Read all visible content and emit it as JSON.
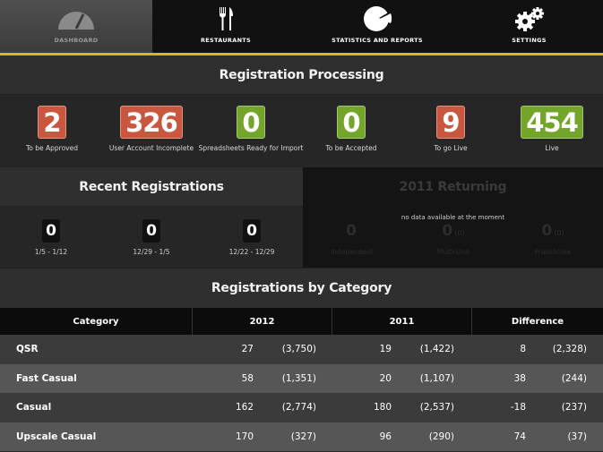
{
  "nav": {
    "items": [
      {
        "label": "Dashboard",
        "icon": "gauge-icon",
        "active": true
      },
      {
        "label": "Restaurants",
        "icon": "fork-knife-icon",
        "active": false
      },
      {
        "label": "Statistics and Reports",
        "icon": "pie-chart-icon",
        "active": false
      },
      {
        "label": "Settings",
        "icon": "gears-icon",
        "active": false
      }
    ],
    "accent": "#e8b11c"
  },
  "processing": {
    "title": "Registration Processing",
    "stats": [
      {
        "value": "2",
        "label": "To be Approved",
        "color": "#c9563e"
      },
      {
        "value": "326",
        "label": "User Account Incomplete",
        "color": "#c9563e"
      },
      {
        "value": "0",
        "label": "Spreadsheets Ready for Import",
        "color": "#72a52a"
      },
      {
        "value": "0",
        "label": "To be Accepted",
        "color": "#72a52a"
      },
      {
        "value": "9",
        "label": "To go Live",
        "color": "#c9563e"
      },
      {
        "value": "454",
        "label": "Live",
        "color": "#72a52a"
      }
    ]
  },
  "recent": {
    "title": "Recent Registrations",
    "items": [
      {
        "value": "0",
        "label": "1/5 - 1/12"
      },
      {
        "value": "0",
        "label": "12/29 - 1/5"
      },
      {
        "value": "0",
        "label": "12/22 - 12/29"
      }
    ]
  },
  "returning": {
    "title": "2011 Returning",
    "no_data": "no data available at the moment",
    "items": [
      {
        "value": "0",
        "paren": "",
        "label": "Independent"
      },
      {
        "value": "0",
        "paren": "(0)",
        "label": "Multi-Unit"
      },
      {
        "value": "0",
        "paren": "(0)",
        "label": "Franchisee"
      }
    ]
  },
  "category": {
    "title": "Registrations by Category",
    "headers": [
      "Category",
      "2012",
      "2011",
      "Difference"
    ],
    "rows": [
      {
        "name": "QSR",
        "y2012": "27",
        "y2012p": "(3,750)",
        "y2011": "19",
        "y2011p": "(1,422)",
        "diff": "8",
        "diffp": "(2,328)"
      },
      {
        "name": "Fast Casual",
        "y2012": "58",
        "y2012p": "(1,351)",
        "y2011": "20",
        "y2011p": "(1,107)",
        "diff": "38",
        "diffp": "(244)"
      },
      {
        "name": "Casual",
        "y2012": "162",
        "y2012p": "(2,774)",
        "y2011": "180",
        "y2011p": "(2,537)",
        "diff": "-18",
        "diffp": "(237)"
      },
      {
        "name": "Upscale Casual",
        "y2012": "170",
        "y2012p": "(327)",
        "y2011": "96",
        "y2011p": "(290)",
        "diff": "74",
        "diffp": "(37)"
      }
    ]
  }
}
